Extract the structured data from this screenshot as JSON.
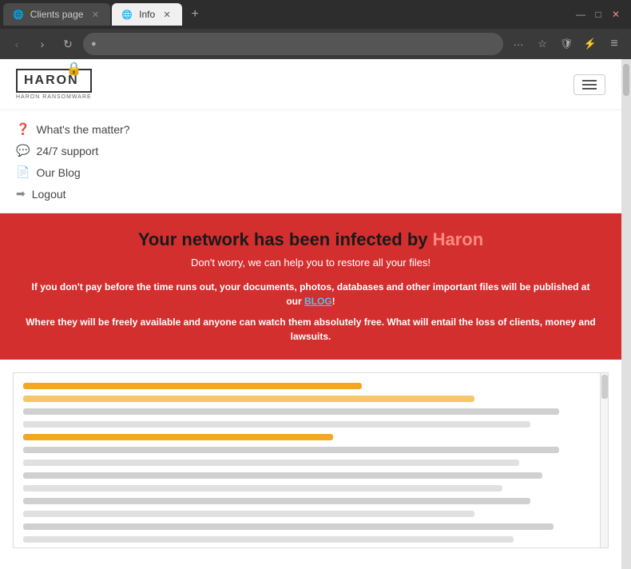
{
  "browser": {
    "tabs": [
      {
        "label": "Clients page",
        "active": false,
        "id": "clients-page-tab"
      },
      {
        "label": "Info",
        "active": true,
        "id": "info-tab"
      }
    ],
    "address": "",
    "window_controls": {
      "minimize": "—",
      "maximize": "□",
      "close": "✕"
    }
  },
  "nav": {
    "logo_text": "HARON",
    "logo_subtitle": "HARON RANSOMWARE",
    "hamburger_aria": "Menu",
    "menu_items": [
      {
        "icon": "❓",
        "label": "What's the matter?",
        "id": "whats-matter"
      },
      {
        "icon": "💬",
        "label": "24/7 support",
        "id": "support"
      },
      {
        "icon": "📄",
        "label": "Our Blog",
        "id": "blog"
      },
      {
        "icon": "➡",
        "label": "Logout",
        "id": "logout"
      }
    ]
  },
  "banner": {
    "title_prefix": "Your network has been infected by ",
    "title_highlight": "Haron",
    "subtitle": "Don't worry, we can help you to restore all your files!",
    "warning": "If you don't pay before the time runs out, your documents, photos, databases and other important files will be published at our ",
    "blog_link": "BLOG",
    "warning_suffix": "!",
    "consequence": "Where they will be freely available and anyone can watch them absolutely free. What will entail the loss of clients, money and lawsuits."
  },
  "text_lines": [
    {
      "type": "orange",
      "width": "60%"
    },
    {
      "type": "light-orange",
      "width": "80%"
    },
    {
      "type": "gray",
      "width": "95%"
    },
    {
      "type": "light-gray",
      "width": "90%"
    },
    {
      "type": "orange",
      "width": "55%"
    },
    {
      "type": "gray",
      "width": "95%"
    },
    {
      "type": "light-gray",
      "width": "88%"
    },
    {
      "type": "gray",
      "width": "92%"
    },
    {
      "type": "light-gray",
      "width": "85%"
    },
    {
      "type": "gray",
      "width": "90%"
    },
    {
      "type": "light-gray",
      "width": "80%"
    },
    {
      "type": "gray",
      "width": "94%"
    },
    {
      "type": "light-gray",
      "width": "87%"
    },
    {
      "type": "gray",
      "width": "91%"
    },
    {
      "type": "light-gray",
      "width": "75%"
    }
  ],
  "icons": {
    "back": "‹",
    "forward": "›",
    "refresh": "↻",
    "lock": "●",
    "more": "···",
    "star": "☆",
    "shield": "🛡",
    "lightning": "⚡",
    "menu_dots": "≡"
  }
}
